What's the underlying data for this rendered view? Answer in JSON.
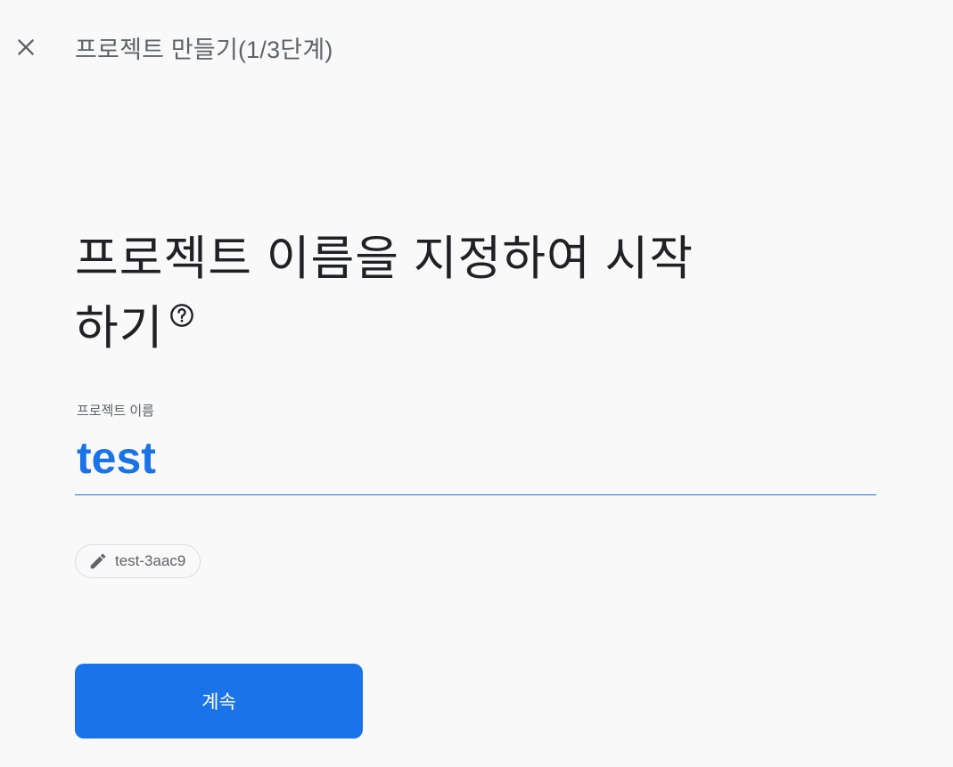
{
  "header": {
    "title": "프로젝트 만들기(1/3단계)",
    "close_icon": "close-icon"
  },
  "main": {
    "heading": "프로젝트 이름을 지정하여 시작하기",
    "help_icon": "help-circle-icon",
    "project_name_field": {
      "label": "프로젝트 이름",
      "value": "test"
    },
    "project_id_chip": {
      "icon": "pencil-icon",
      "text": "test-3aac9"
    },
    "continue_label": "계속"
  },
  "colors": {
    "accent": "#1a73e8",
    "background": "#f9f9f9",
    "text_secondary": "#5f6368"
  }
}
